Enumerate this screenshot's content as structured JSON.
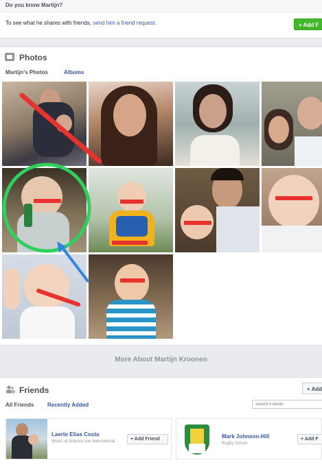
{
  "know": {
    "title": "Do you know Martijn?",
    "text": "To see what he shares with friends, ",
    "link": "send him a friend request.",
    "button": "+ Add F"
  },
  "photos": {
    "title": "Photos",
    "tab_my": "Martijn's Photos",
    "tab_albums": "Albums"
  },
  "more_about": "More About Martijn Kroonen",
  "friends": {
    "title": "Friends",
    "add_button": "+ Add",
    "tab_all": "All Friends",
    "tab_recent": "Recently Added",
    "search_placeholder": "Search Friends",
    "items": [
      {
        "name": "Laerte Elias Costa",
        "sub": "Works at Alliance one International",
        "button": "+ Add Friend"
      },
      {
        "name": "Mark Johnson-Hill",
        "sub": "Rugby School",
        "button": "+ Add F"
      }
    ]
  },
  "colors": {
    "link": "#365899",
    "green_button": "#42b72a",
    "annotation_red": "#e8322d",
    "annotation_green": "#2fd05c",
    "annotation_blue": "#2f86e0"
  }
}
